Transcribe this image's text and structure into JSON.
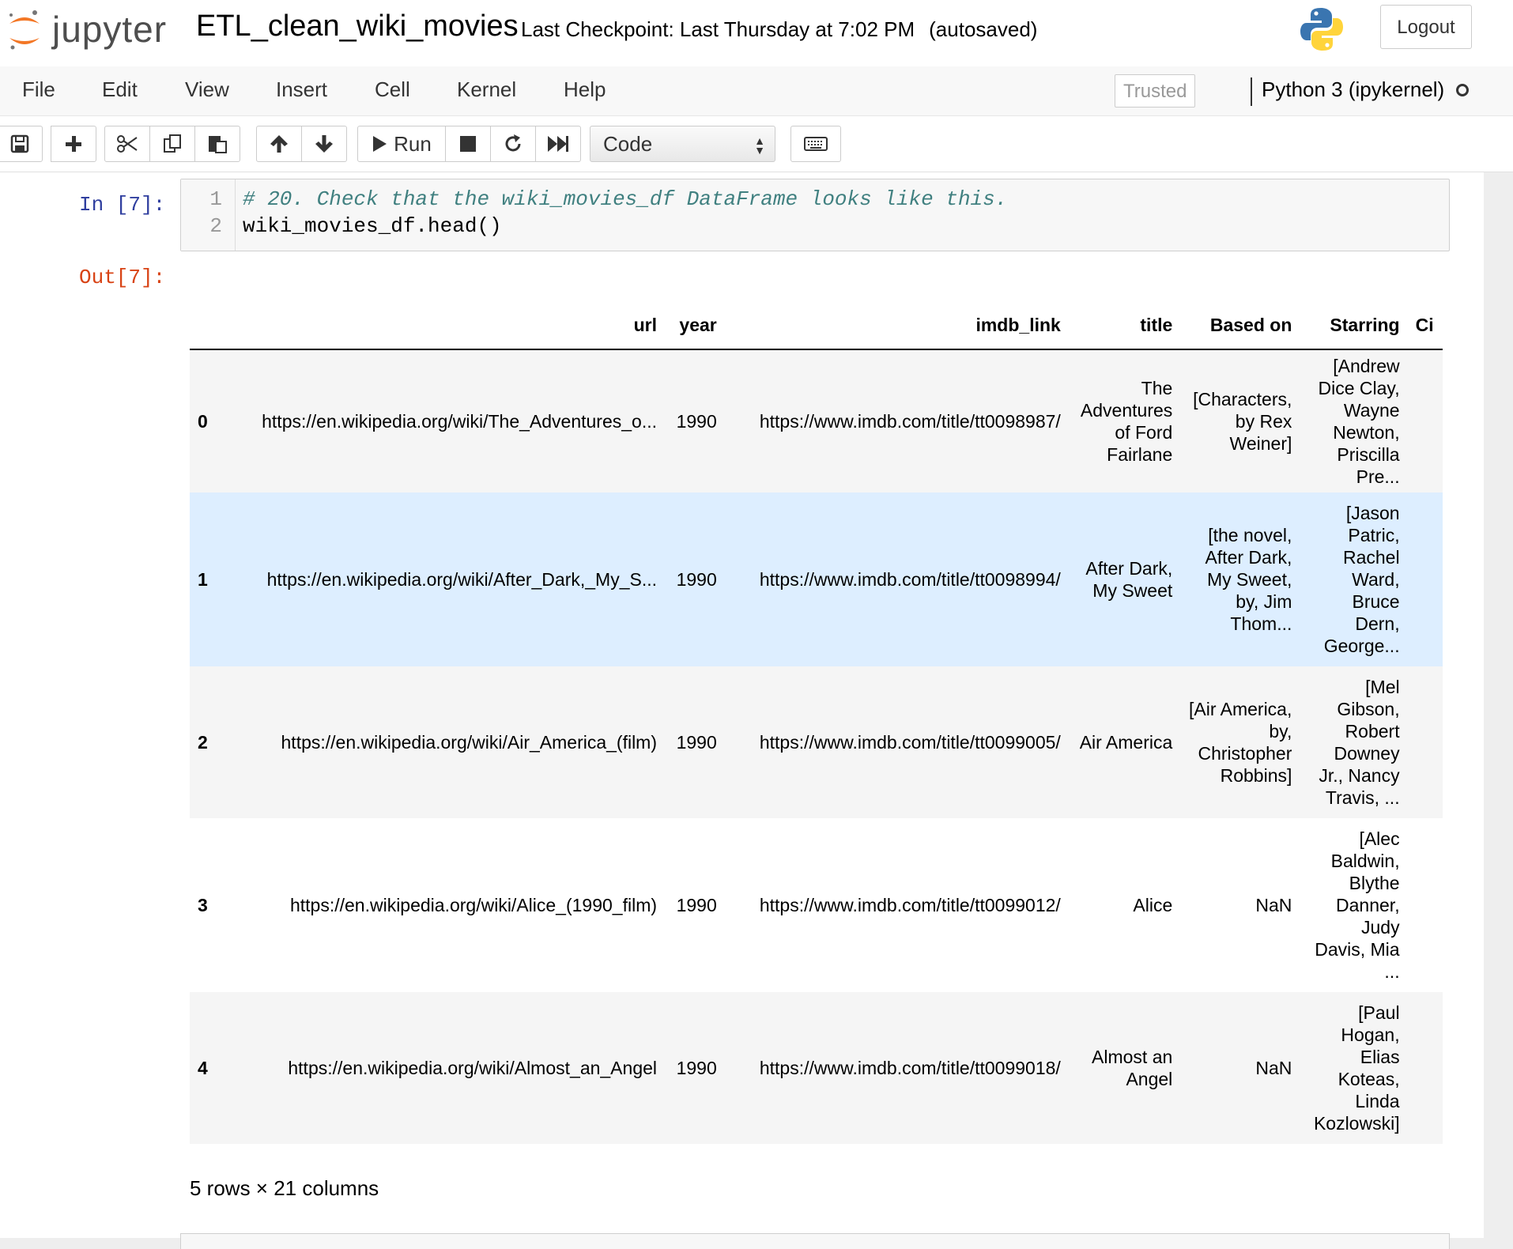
{
  "header": {
    "logo_text": "jupyter",
    "notebook_name": "ETL_clean_wiki_movies",
    "checkpoint": "Last Checkpoint: Last Thursday at 7:02 PM",
    "autosave": "(autosaved)",
    "logout_label": "Logout"
  },
  "menubar": {
    "items": [
      "File",
      "Edit",
      "View",
      "Insert",
      "Cell",
      "Kernel",
      "Help"
    ],
    "trusted": "Trusted",
    "kernel_name": "Python 3 (ipykernel)"
  },
  "toolbar": {
    "run_label": "Run",
    "cell_type": "Code",
    "icons": [
      "save-icon",
      "plus-icon",
      "scissors-icon",
      "copy-icon",
      "paste-icon",
      "arrow-up-icon",
      "arrow-down-icon",
      "play-icon",
      "stop-icon",
      "restart-icon",
      "fast-forward-icon",
      "keyboard-icon"
    ]
  },
  "cell": {
    "in_prompt": "In [7]:",
    "out_prompt": "Out[7]:",
    "lines": [
      {
        "no": "1",
        "comment": "# 20. Check that the wiki_movies_df DataFrame looks like this."
      },
      {
        "no": "2",
        "code": "wiki_movies_df.head()"
      }
    ]
  },
  "dataframe": {
    "columns": [
      "",
      "url",
      "year",
      "imdb_link",
      "title",
      "Based on",
      "Starring",
      "Ci"
    ],
    "rows": [
      [
        "0",
        "https://en.wikipedia.org/wiki/The_Adventures_o...",
        "1990",
        "https://www.imdb.com/title/tt0098987/",
        "The Adventures of Ford Fairlane",
        "[Characters, by Rex Weiner]",
        "[Andrew Dice Clay, Wayne Newton, Priscilla Pre...",
        ""
      ],
      [
        "1",
        "https://en.wikipedia.org/wiki/After_Dark,_My_S...",
        "1990",
        "https://www.imdb.com/title/tt0098994/",
        "After Dark, My Sweet",
        "[the novel, After Dark, My Sweet, by, Jim Thom...",
        "[Jason Patric, Rachel Ward, Bruce Dern, George...",
        ""
      ],
      [
        "2",
        "https://en.wikipedia.org/wiki/Air_America_(film)",
        "1990",
        "https://www.imdb.com/title/tt0099005/",
        "Air America",
        "[Air America, by, Christopher Robbins]",
        "[Mel Gibson, Robert Downey Jr., Nancy Travis, ...",
        ""
      ],
      [
        "3",
        "https://en.wikipedia.org/wiki/Alice_(1990_film)",
        "1990",
        "https://www.imdb.com/title/tt0099012/",
        "Alice",
        "NaN",
        "[Alec Baldwin, Blythe Danner, Judy Davis, Mia ...",
        ""
      ],
      [
        "4",
        "https://en.wikipedia.org/wiki/Almost_an_Angel",
        "1990",
        "https://www.imdb.com/title/tt0099018/",
        "Almost an Angel",
        "NaN",
        "[Paul Hogan, Elias Koteas, Linda Kozlowski]",
        ""
      ]
    ],
    "summary": "5 rows × 21 columns"
  },
  "colors": {
    "in_prompt": "#303f9f",
    "out_prompt": "#d84315",
    "comment": "#408080",
    "row_hover": "#ddeeff",
    "logo_orange": "#f37726"
  }
}
